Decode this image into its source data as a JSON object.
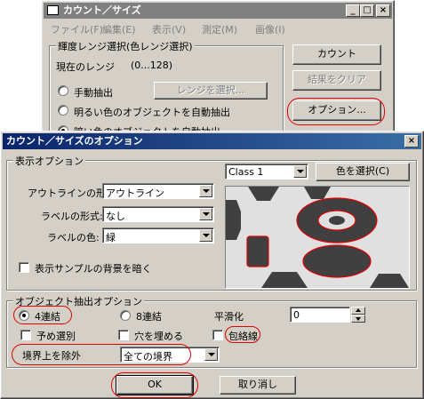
{
  "bg_window": {
    "title": "カウント／サイズ",
    "menu": [
      "ファイル(F)",
      "編集(E)",
      "表示(V)",
      "測定(M)",
      "画像(I)"
    ],
    "group_title": "輝度レンジ選択(色レンジ選択)",
    "current_range_label": "現在のレンジ",
    "current_range_value": "(0...128)",
    "radio_manual": "手動抽出",
    "radio_bright": "明るい色のオブジェクトを自動抽出",
    "radio_dark": "暗い色のオブジェクトを自動抽出",
    "select_range_button": "レンジを選択...",
    "count_button": "カウント",
    "clear_button": "結果をクリア",
    "options_button": "オプション..."
  },
  "dialog": {
    "title": "カウント／サイズのオプション",
    "display_group": "表示オプション",
    "class_value": "Class 1",
    "color_select_button": "色を選択(C)",
    "outline_label": "アウトラインの形式:",
    "outline_value": "アウトライン",
    "label_style_label": "ラベルの形式:",
    "label_style_value": "なし",
    "label_color_label": "ラベルの色:",
    "label_color_value": "緑",
    "darken_background_label": "表示サンプルの背景を暗く",
    "extract_group": "オブジェクト抽出オプション",
    "connect4_label": "4連結",
    "connect8_label": "8連結",
    "smoothing_label": "平滑化",
    "smoothing_value": "0",
    "preselect_label": "予め選別",
    "fill_holes_label": "穴を埋める",
    "hull_label": "包絡線",
    "exclude_border_label": "境界上を除外",
    "exclude_border_value": "全ての境界",
    "ok_button": "OK",
    "cancel_button": "取り消し"
  },
  "colors": {
    "highlight_ring": "#e00000",
    "preview_shapes": "#404040",
    "preview_bg": "#e0e0e0"
  }
}
